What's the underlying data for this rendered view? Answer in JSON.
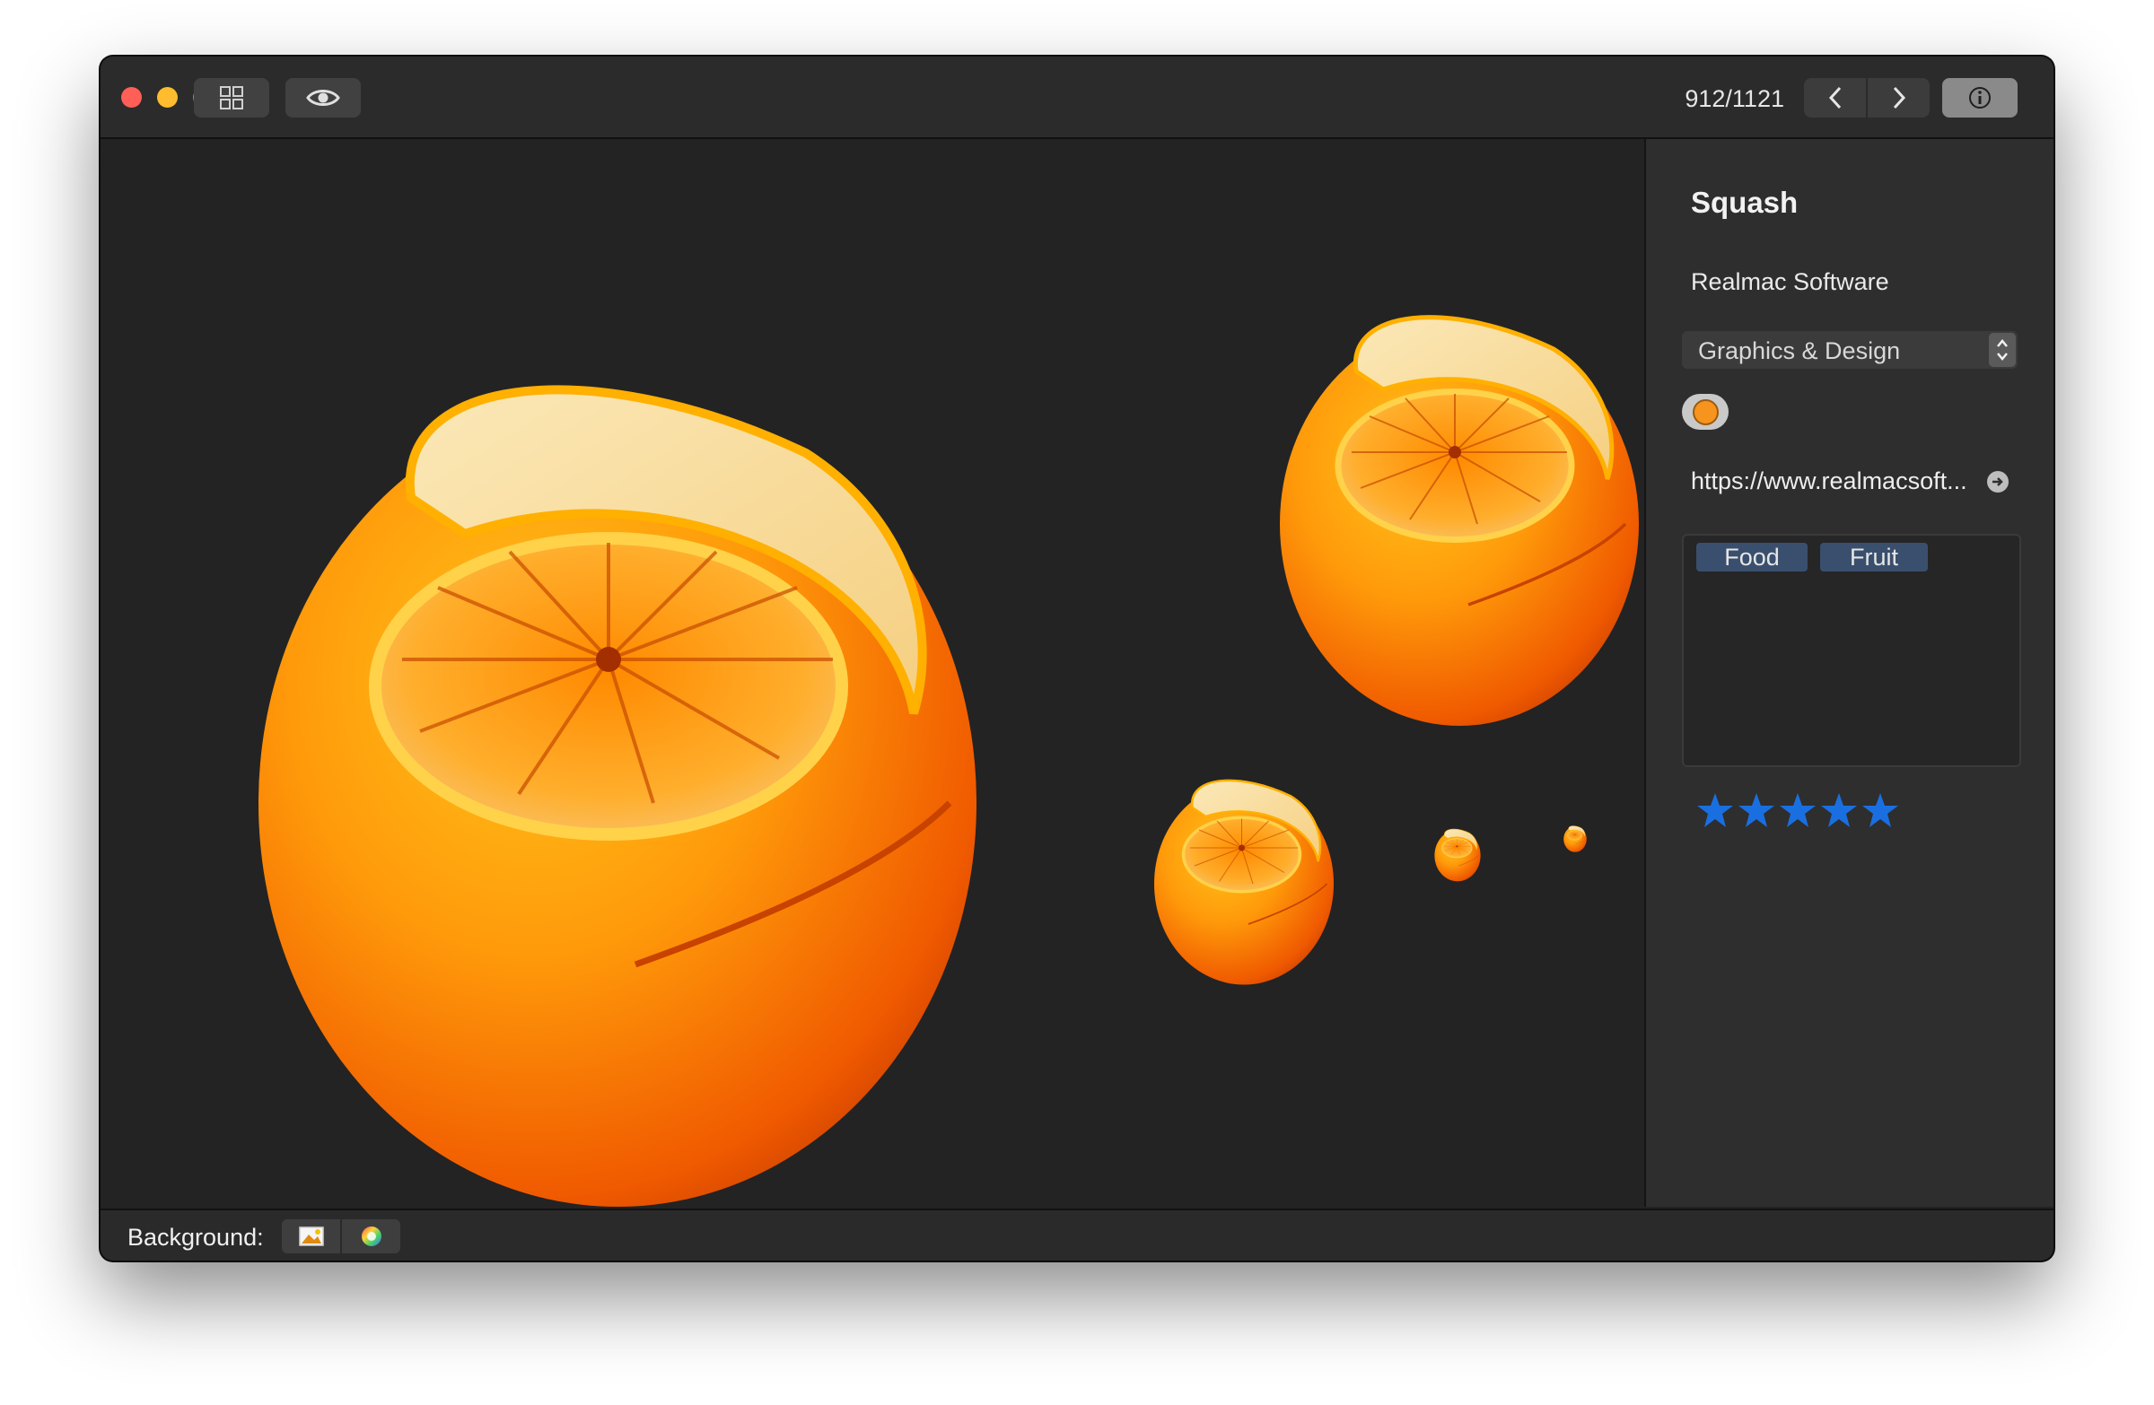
{
  "window": {
    "traffic_lights": [
      "close",
      "minimize",
      "zoom"
    ],
    "toolbar": {
      "grid_view_icon": "grid-icon",
      "preview_icon": "eye-icon",
      "counter": "912/1121",
      "prev_icon": "chevron-left-icon",
      "next_icon": "chevron-right-icon",
      "info_icon": "info-icon"
    }
  },
  "canvas": {
    "image_previews": [
      "orange-icon-large",
      "orange-icon-medium",
      "orange-icon-small",
      "orange-icon-tiny",
      "orange-icon-micro"
    ]
  },
  "sidebar": {
    "app_name": "Squash",
    "developer": "Realmac Software",
    "category": "Graphics & Design",
    "color_label": "#f7941d",
    "url": "https://www.realmacsoft...",
    "tags": [
      "Food",
      "Fruit"
    ],
    "rating": 5
  },
  "statusbar": {
    "background_label": "Background:",
    "bg_options": [
      "image-icon",
      "color-wheel-icon"
    ]
  },
  "colors": {
    "accent_blue": "#1a6fe0",
    "orange": "#f7941d"
  }
}
